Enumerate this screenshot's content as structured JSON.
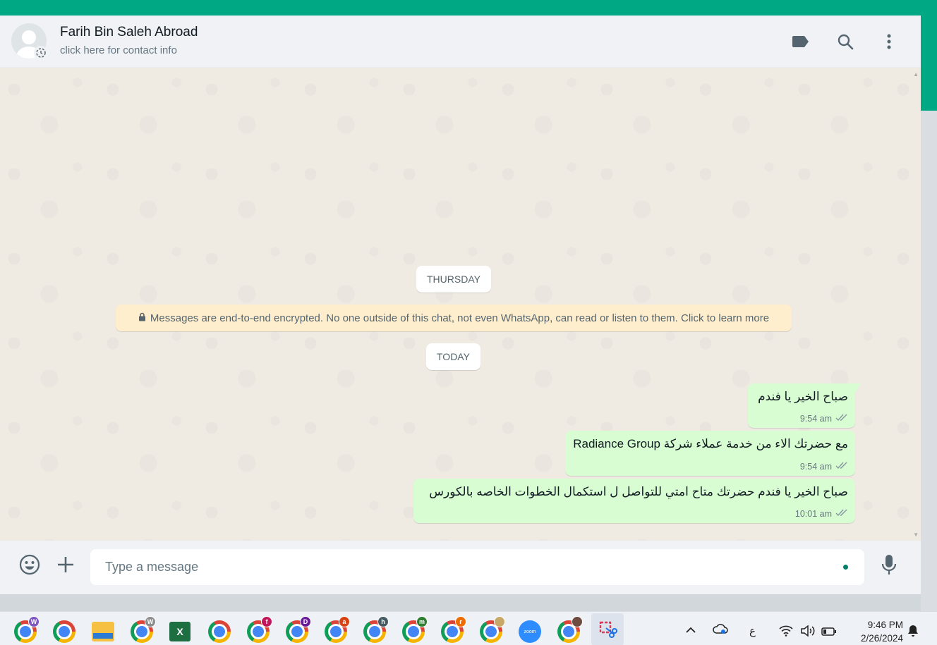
{
  "colors": {
    "brand": "#00a884",
    "outgoing_bubble": "#d9fdd3",
    "encryption_note_bg": "#ffeecd",
    "read_ticks": "#8696a0"
  },
  "header": {
    "contact_name": "Farih Bin Saleh Abroad",
    "contact_subtitle": "click here for contact info",
    "icons": [
      "label-icon",
      "search-icon",
      "menu-icon"
    ]
  },
  "chat": {
    "date_dividers": [
      "THURSDAY",
      "TODAY"
    ],
    "encryption_notice": "Messages are end-to-end encrypted. No one outside of this chat, not even WhatsApp, can read or listen to them. Click to learn more",
    "messages": [
      {
        "text": "صباح الخير يا فندم",
        "time": "9:54 am",
        "status": "read"
      },
      {
        "text": "مع حضرتك الاء من خدمة عملاء شركة Radiance Group",
        "time": "9:54 am",
        "status": "read"
      },
      {
        "text": "صباح الخير يا فندم حضرتك متاح امتي للتواصل ل استكمال الخطوات الخاصه بالكورس",
        "time": "10:01 am",
        "status": "read"
      }
    ]
  },
  "composer": {
    "placeholder": "Type a message",
    "icons": [
      "emoji-icon",
      "attach-icon",
      "microphone-icon"
    ]
  },
  "taskbar": {
    "badges": [
      "W",
      "W",
      "f",
      "D",
      "a",
      "h",
      "m",
      "r"
    ],
    "zoom_label": "zoom",
    "excel_label": "X",
    "keyboard_indicator": "ع",
    "time": "9:46 PM",
    "date": "2/26/2024"
  }
}
